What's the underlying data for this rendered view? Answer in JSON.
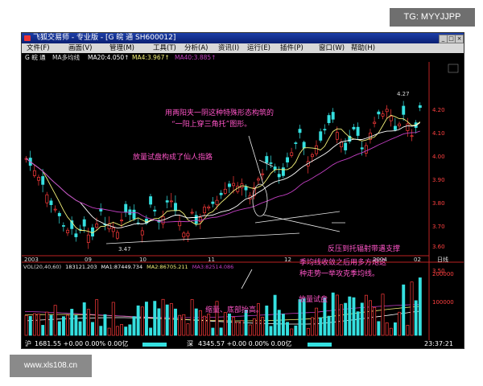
{
  "overlay": {
    "tg_label": "TG: MYYJJPP",
    "site_watermark": "www.xls108.cn"
  },
  "window": {
    "title": "飞狐交易师 - 专业版 - [G 皖  通 SH600012]",
    "minimize_glyph": "_",
    "maximize_glyph": "□",
    "close_glyph": "×"
  },
  "menu": [
    "文件(F)",
    "画面(V)",
    "管理(M)",
    "工具(T)",
    "分析(A)",
    "资讯(I)",
    "运行(E)",
    "插件(P)",
    "窗口(W)",
    "帮助(H)"
  ],
  "info": {
    "stock": "G 皖  通",
    "ma_label": "MA多均线",
    "ma20": "MA20:4.050↑",
    "ma4": "MA4:3.967↑",
    "ma40": "MA40:3.885↑"
  },
  "annotations": {
    "top1": "用两阳夹一阴这种特殊形态构筑的",
    "top2": "“一阳上穿三角托”图形。",
    "left": "放量试盘构成了仙人指路",
    "right1": "反压到托辐射带遇支撑",
    "right2_1": "季均线收敛之后用多方炮这",
    "right2_2": "种走势一举攻克季均线。",
    "vol_test": "放量试盘",
    "vol_shrink": "缩量、底部抬高。"
  },
  "price_labels": {
    "high": "4.27",
    "low": "3.47"
  },
  "price_axis": [
    "4.20",
    "4.10",
    "4.00",
    "3.90",
    "3.80",
    "3.70",
    "3.60",
    "3.50"
  ],
  "date_axis": [
    "2003",
    "09",
    "10",
    "11",
    "12",
    "2004",
    "02"
  ],
  "period_label": "日线",
  "volume": {
    "label": "VOL(20,40,60)",
    "value": "183121.203",
    "ma1": "MA1:87449.734",
    "ma2": "MA2:86705.211",
    "ma3": "MA3:82514.086",
    "axis": [
      "200000",
      "100000"
    ]
  },
  "status": {
    "sh_label": "沪",
    "sh_value": "1681.55 +0.00 0.00% 0.00亿",
    "sz_label": "深",
    "sz_value": "4345.57 +0.00 0.00% 0.00亿",
    "time": "23:37:21"
  },
  "colors": {
    "up": "#ff3b3b",
    "down": "#35e0e0",
    "ma_white": "#ffffff",
    "ma_yellow": "#f5f27a",
    "ma_magenta": "#c23fc2",
    "annotation": "#ff55c8"
  }
}
